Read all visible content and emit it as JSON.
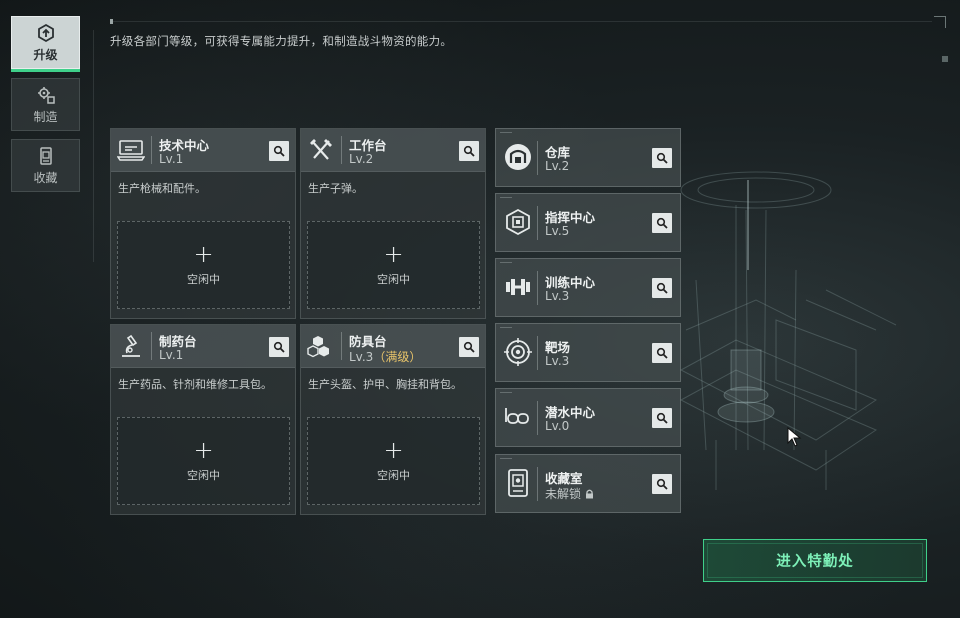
{
  "nav": {
    "items": [
      {
        "label": "升级",
        "icon": "upgrade-icon",
        "active": true
      },
      {
        "label": "制造",
        "icon": "craft-gears-icon",
        "active": false
      },
      {
        "label": "收藏",
        "icon": "collection-icon",
        "active": false
      }
    ]
  },
  "description": "升级各部门等级，可获得专属能力提升，和制造战斗物资的能力。",
  "departments": [
    {
      "name": "技术中心",
      "level": "Lv.1",
      "desc": "生产枪械和配件。",
      "icon": "tech-center-icon",
      "slot_label": "空闲中"
    },
    {
      "name": "工作台",
      "level": "Lv.2",
      "desc": "生产子弹。",
      "icon": "workbench-tools-icon",
      "slot_label": "空闲中"
    },
    {
      "name": "制药台",
      "level": "Lv.1",
      "desc": "生产药品、针剂和维修工具包。",
      "icon": "microscope-icon",
      "slot_label": "空闲中"
    },
    {
      "name": "防具台",
      "level": "Lv.3",
      "level_note": "（满级）",
      "desc": "生产头盔、护甲、胸挂和背包。",
      "icon": "armor-cubes-icon",
      "slot_label": "空闲中"
    }
  ],
  "facilities": [
    {
      "name": "仓库",
      "level": "Lv.2",
      "icon": "warehouse-icon"
    },
    {
      "name": "指挥中心",
      "level": "Lv.5",
      "icon": "command-chip-icon"
    },
    {
      "name": "训练中心",
      "level": "Lv.3",
      "icon": "dumbbell-icon"
    },
    {
      "name": "靶场",
      "level": "Lv.3",
      "icon": "target-icon"
    },
    {
      "name": "潜水中心",
      "level": "Lv.0",
      "icon": "diving-mask-icon"
    },
    {
      "name": "收藏室",
      "level": "未解锁",
      "icon": "collection-room-icon",
      "locked": true
    }
  ],
  "enter_button": "进入特勤处",
  "colors": {
    "accent": "#3fd08a",
    "enter_text": "#7df0b8",
    "maxed": "#e8c46a",
    "background": "#1a2123"
  }
}
